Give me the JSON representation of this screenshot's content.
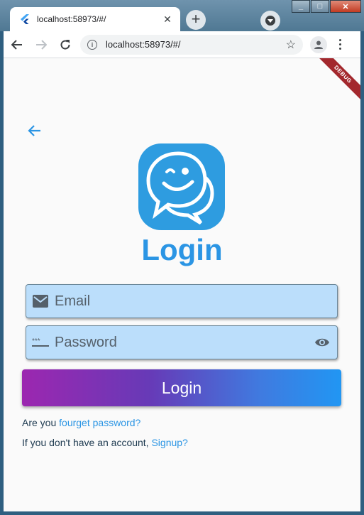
{
  "browser": {
    "tab_title": "localhost:58973/#/",
    "tab_close": "✕",
    "new_tab": "+",
    "url": "localhost:58973/#/",
    "window_controls": [
      "_",
      "□",
      "✕"
    ]
  },
  "flutter": {
    "debug_banner": "DEBUG"
  },
  "page": {
    "title": "Login",
    "email_placeholder": "Email",
    "password_placeholder": "Password",
    "login_button": "Login",
    "forgot_prefix": "Are you ",
    "forgot_link": "fourget password?",
    "signup_prefix": "If you don't have an account, ",
    "signup_link": "Signup?"
  },
  "colors": {
    "accent": "#2b95e4",
    "field_bg": "#bbdefb",
    "gradient_start": "#9c27b0",
    "gradient_end": "#2196f3",
    "debug_banner": "#a3282d"
  },
  "icons": [
    "flutter-favicon-icon",
    "back-arrow-icon",
    "forward-arrow-icon",
    "reload-icon",
    "info-icon",
    "star-icon",
    "profile-icon",
    "menu-icon",
    "app-logo-icon",
    "email-icon",
    "password-icon",
    "visibility-icon"
  ]
}
